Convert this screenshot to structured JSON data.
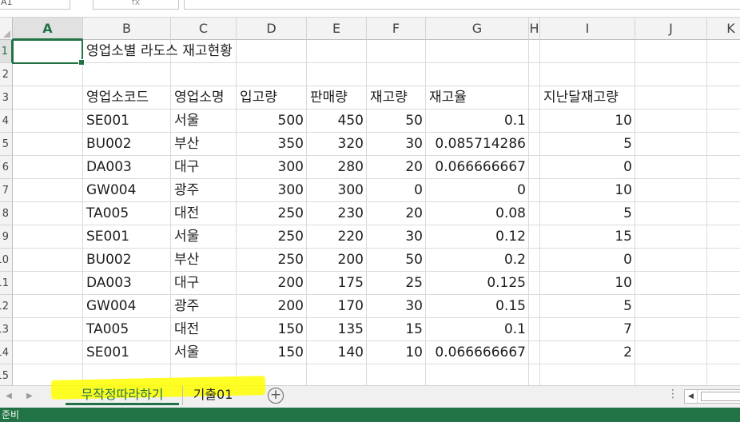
{
  "name_box": "A1",
  "function_box": "fx",
  "columns": [
    "A",
    "B",
    "C",
    "D",
    "E",
    "F",
    "G",
    "H",
    "I",
    "J",
    "K"
  ],
  "rows": [
    "1",
    "2",
    "3",
    "4",
    "5",
    "6",
    "7",
    "8",
    "9",
    "10",
    "11",
    "12",
    "13",
    "14",
    "15"
  ],
  "title": "영업소별 라도스 재고현황",
  "headers": [
    "영업소코드",
    "영업소명",
    "입고량",
    "판매량",
    "재고량",
    "재고율",
    "지난달재고량"
  ],
  "data_rows": [
    [
      "SE001",
      "서울",
      "500",
      "450",
      "50",
      "0.1",
      "10"
    ],
    [
      "BU002",
      "부산",
      "350",
      "320",
      "30",
      "0.085714286",
      "5"
    ],
    [
      "DA003",
      "대구",
      "300",
      "280",
      "20",
      "0.066666667",
      "0"
    ],
    [
      "GW004",
      "광주",
      "300",
      "300",
      "0",
      "0",
      "10"
    ],
    [
      "TA005",
      "대전",
      "250",
      "230",
      "20",
      "0.08",
      "5"
    ],
    [
      "SE001",
      "서울",
      "250",
      "220",
      "30",
      "0.12",
      "15"
    ],
    [
      "BU002",
      "부산",
      "250",
      "200",
      "50",
      "0.2",
      "0"
    ],
    [
      "DA003",
      "대구",
      "200",
      "175",
      "25",
      "0.125",
      "10"
    ],
    [
      "GW004",
      "광주",
      "200",
      "170",
      "30",
      "0.15",
      "5"
    ],
    [
      "TA005",
      "대전",
      "150",
      "135",
      "15",
      "0.1",
      "7"
    ],
    [
      "SE001",
      "서울",
      "150",
      "140",
      "10",
      "0.066666667",
      "2"
    ]
  ],
  "sheet_tabs": [
    "무작정따라하기",
    "기출01"
  ],
  "status_text": "준비",
  "colors": {
    "accent": "#217346",
    "highlight": "#ffff00"
  }
}
